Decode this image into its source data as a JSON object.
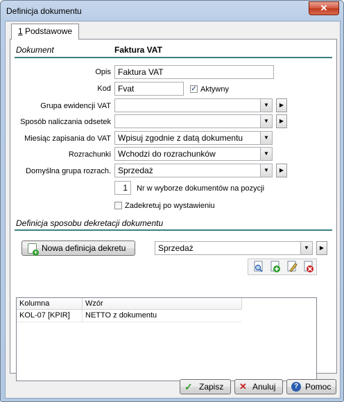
{
  "window": {
    "title": "Definicja dokumentu",
    "close_glyph": "✕"
  },
  "tab": {
    "label": "1 Podstawowe"
  },
  "section_document": {
    "label": "Dokument",
    "value": "Faktura VAT"
  },
  "form": {
    "opis": {
      "label": "Opis",
      "value": "Faktura VAT"
    },
    "kod": {
      "label": "Kod",
      "value": "Fvat"
    },
    "aktywny": {
      "label": "Aktywny",
      "checked": true
    },
    "grupa_ewidencji": {
      "label": "Grupa ewidencji VAT",
      "value": ""
    },
    "sposob_naliczania": {
      "label": "Sposób naliczania odsetek",
      "value": ""
    },
    "miesiac_zapisania": {
      "label": "Miesiąc zapisania do VAT",
      "value": "Wpisuj zgodnie z datą dokumentu"
    },
    "rozrachunki": {
      "label": "Rozrachunki",
      "value": "Wchodzi do rozrachunków"
    },
    "domyslna_grupa": {
      "label": "Domyślna grupa rozrach.",
      "value": "Sprzedaż"
    },
    "nr_w_wyborze": {
      "value": "1",
      "label": "Nr w wyborze dokumentów na pozycji"
    },
    "zadekretuj": {
      "label": "Zadekretuj po wystawieniu",
      "checked": false
    }
  },
  "section_dekret": {
    "label": "Definicja sposobu dekretacji dokumentu"
  },
  "dekret": {
    "new_button_label": "Nowa definicja dekretu",
    "type_value": "Sprzedaż",
    "toolbar": [
      "preview-icon",
      "add-icon",
      "edit-icon",
      "delete-icon"
    ]
  },
  "grid": {
    "columns": [
      "Kolumna",
      "Wzór"
    ],
    "rows": [
      [
        "KOL-07 [KPIR]",
        "NETTO z dokumentu"
      ]
    ]
  },
  "buttons": {
    "save": "Zapisz",
    "cancel": "Anuluj",
    "help": "Pomoc"
  },
  "colors": {
    "section_line": "#3a8080",
    "save_accent": "#2e9e2e",
    "cancel_accent": "#c81e1e",
    "help_accent": "#2a5db0"
  }
}
